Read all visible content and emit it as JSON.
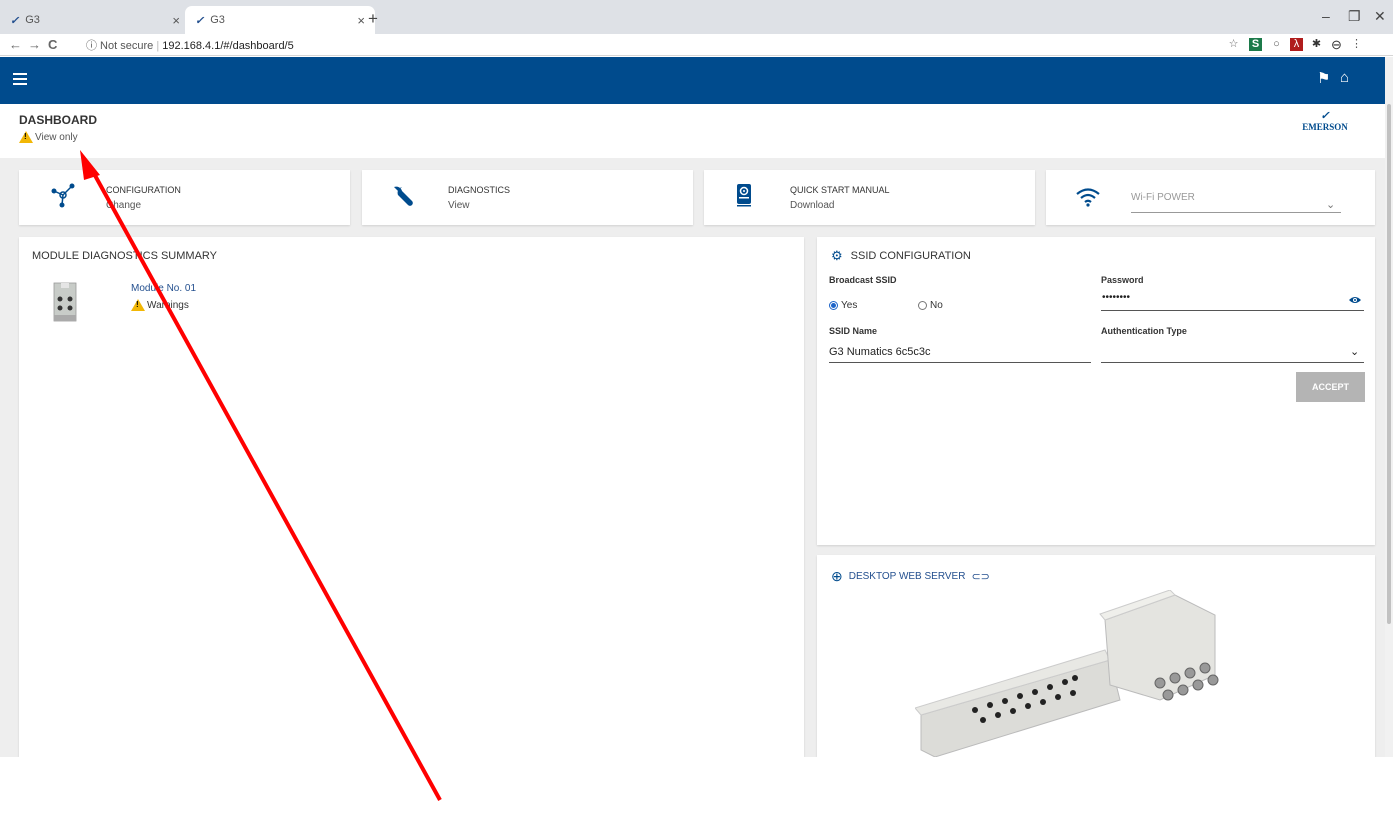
{
  "browser": {
    "tabs": [
      {
        "favicon": "emerson-logo-icon",
        "title": "G3",
        "close": "×"
      },
      {
        "favicon": "emerson-logo-icon",
        "title": "G3",
        "close": "×"
      }
    ],
    "new_tab": "+",
    "window_controls": {
      "minimize": "–",
      "restore": "❐",
      "close": "✕"
    },
    "nav": {
      "back": "←",
      "forward": "→",
      "reload": "C"
    },
    "security_label": "ⓘ Not secure",
    "url": "192.168.4.1/#/dashboard/5",
    "extensions": [
      "star-icon",
      "s-extension-icon",
      "circle-extension-icon",
      "pdf-extension-icon",
      "puzzle-icon",
      "profile-icon",
      "kebab-menu-icon"
    ]
  },
  "appbar": {
    "color": "#004b8d",
    "icons": [
      "menu-icon",
      "flag-icon",
      "home-icon"
    ]
  },
  "page": {
    "title": "DASHBOARD",
    "mode": "View only",
    "logo_text": "EMERSON"
  },
  "tiles": [
    {
      "title": "CONFIGURATION",
      "subtitle": "Change",
      "icon": "network-icon"
    },
    {
      "title": "DIAGNOSTICS",
      "subtitle": "View",
      "icon": "wrench-icon"
    },
    {
      "title": "QUICK START MANUAL",
      "subtitle": "Download",
      "icon": "manual-icon"
    },
    {
      "title": "Wi-Fi POWER",
      "icon": "wifi-icon",
      "selected_value": ""
    }
  ],
  "module_summary": {
    "title": "MODULE DIAGNOSTICS SUMMARY",
    "modules": [
      {
        "name": "Module No. 01",
        "status": "Warnings"
      }
    ]
  },
  "ssid": {
    "title": "SSID CONFIGURATION",
    "broadcast_label": "Broadcast SSID",
    "yes_label": "Yes",
    "no_label": "No",
    "broadcast_selected": "Yes",
    "password_label": "Password",
    "password_value": "••••••••",
    "ssid_name_label": "SSID Name",
    "ssid_name_value": "G3 Numatics 6c5c3c",
    "auth_label": "Authentication Type",
    "auth_value": "",
    "accept_label": "ACCEPT"
  },
  "desktop_server": {
    "title": "DESKTOP WEB SERVER"
  },
  "colors": {
    "brand_blue": "#004b8d",
    "link_blue": "#24508f",
    "warning_yellow": "#f2b705",
    "annotation_red": "#ff0000"
  }
}
